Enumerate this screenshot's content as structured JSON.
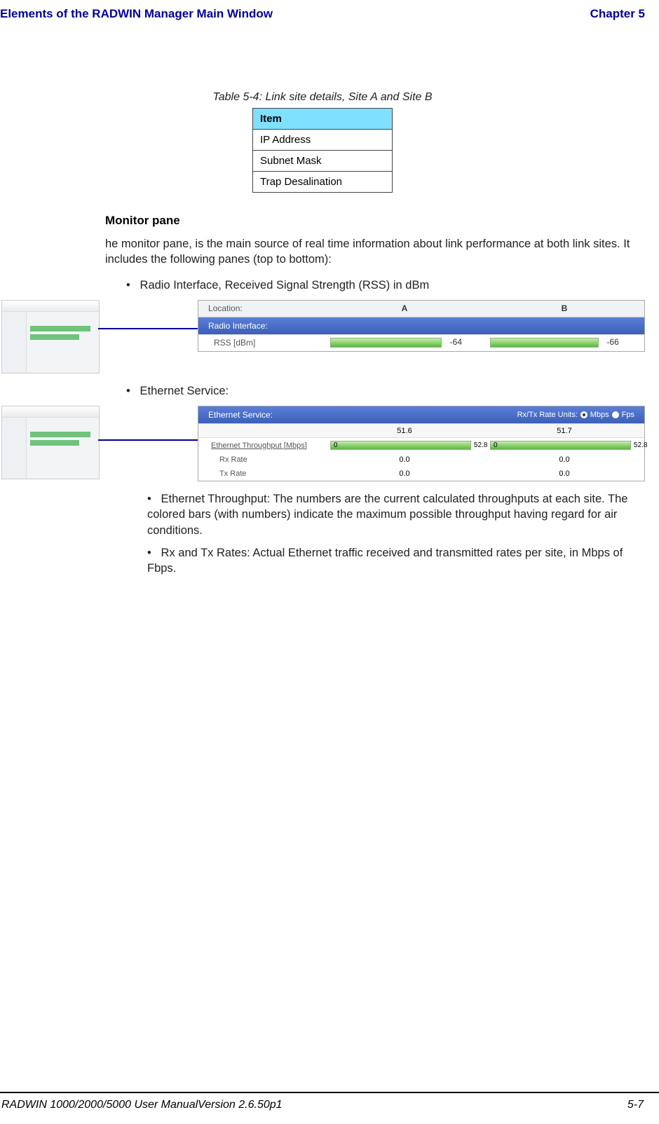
{
  "header": {
    "left": "Elements of the RADWIN Manager Main Window",
    "right": "Chapter 5"
  },
  "table": {
    "caption": "Table 5-4: Link site details, Site A and Site B",
    "header": "Item",
    "rows": [
      "IP Address",
      "Subnet Mask",
      "Trap Desalination"
    ]
  },
  "sections": {
    "monitor_pane_heading": "Monitor pane",
    "monitor_pane_text": "he monitor pane, is the main source of real time information about link performance at both link sites. It includes the following panes (top to bottom):",
    "bullet_radio": "Radio Interface, Received Signal Strength (RSS) in dBm",
    "bullet_ethernet": "Ethernet Service:",
    "sub_bullet_throughput": "Ethernet Throughput: The numbers are the current calculated throughputs at each site. The colored bars (with numbers) indicate the maximum possible throughput having regard for air conditions.",
    "sub_bullet_rates": "Rx and Tx Rates: Actual Ethernet traffic received and transmitted rates per site, in Mbps of Fbps."
  },
  "radio_panel": {
    "location_label": "Location:",
    "col_a": "A",
    "col_b": "B",
    "header": "Radio Interface:",
    "row_label": "RSS [dBm]",
    "val_a": "-64",
    "val_b": "-66"
  },
  "ethernet_panel": {
    "header": "Ethernet Service:",
    "units_label": "Rx/Tx Rate Units:",
    "unit_mbps": "Mbps",
    "unit_fps": "Fps",
    "throughput_label": "Ethernet Throughput [Mbps]",
    "throughput_a": "51.6",
    "throughput_b": "51.7",
    "bar_a_inner": "0",
    "bar_a_end": "52.8",
    "bar_b_inner": "0",
    "bar_b_end": "52.8",
    "rx_label": "Rx Rate",
    "rx_a": "0.0",
    "rx_b": "0.0",
    "tx_label": "Tx Rate",
    "tx_a": "0.0",
    "tx_b": "0.0"
  },
  "footer": {
    "left": "RADWIN 1000/2000/5000 User ManualVersion  2.6.50p1",
    "right": "5-7"
  }
}
